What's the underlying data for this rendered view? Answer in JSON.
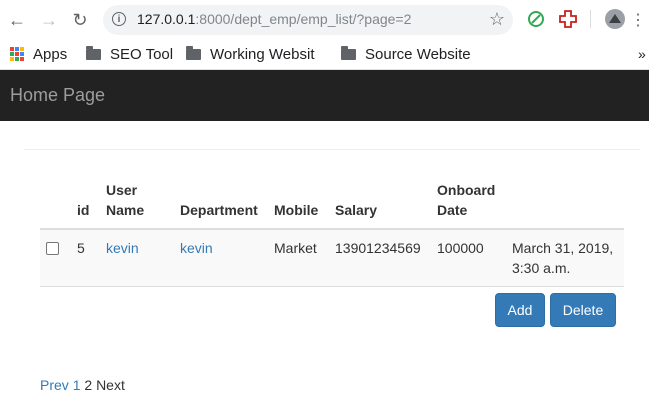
{
  "browser": {
    "url_host": "127.0.0.1",
    "url_rest": ":8000/dept_emp/emp_list/?page=2"
  },
  "bookmarks": {
    "apps": "Apps",
    "items": [
      "SEO Tool",
      "Working Websit",
      "Source Website"
    ]
  },
  "navbar": {
    "brand": "Home Page"
  },
  "table": {
    "headers": {
      "id": "id",
      "user_name": "User Name",
      "department": "Department",
      "mobile": "Mobile",
      "salary": "Salary",
      "onboard": "Onboard Date"
    },
    "rows": [
      {
        "id": "5",
        "user_name": "kevin",
        "department": "kevin",
        "mobile": "Market",
        "salary": "13901234569",
        "onboard": "100000",
        "date": "March 31, 2019, 3:30 a.m."
      }
    ]
  },
  "actions": {
    "add": "Add",
    "delete": "Delete"
  },
  "pagination": {
    "prev": "Prev",
    "page1": "1",
    "current": "2",
    "next": "Next"
  },
  "colors": {
    "navbar": "#222222",
    "primary": "#337ab7",
    "link": "#337ab7"
  }
}
